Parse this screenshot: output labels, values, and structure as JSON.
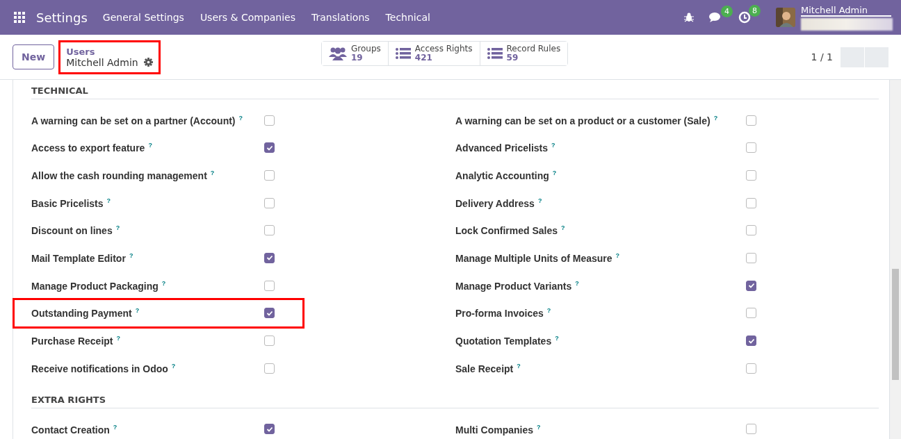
{
  "navbar": {
    "app_title": "Settings",
    "menu": [
      "General Settings",
      "Users & Companies",
      "Translations",
      "Technical"
    ],
    "messages_count": "4",
    "activities_count": "8",
    "user_name": "Mitchell Admin"
  },
  "control_panel": {
    "new_button": "New",
    "breadcrumb": "Users",
    "record_title": "Mitchell Admin",
    "highlighted": true,
    "smart_buttons": [
      {
        "kind": "groups",
        "label": "Groups",
        "count": "19"
      },
      {
        "kind": "list",
        "label": "Access Rights",
        "count": "421"
      },
      {
        "kind": "list",
        "label": "Record Rules",
        "count": "59"
      }
    ],
    "pager": "1 / 1"
  },
  "sections": [
    {
      "title": "TECHNICAL",
      "rows": [
        {
          "left": {
            "label": "A warning can be set on a partner (Account)",
            "checked": false,
            "highlighted": false
          },
          "right": {
            "label": "A warning can be set on a product or a customer (Sale)",
            "checked": false
          }
        },
        {
          "left": {
            "label": "Access to export feature",
            "checked": true,
            "highlighted": false
          },
          "right": {
            "label": "Advanced Pricelists",
            "checked": false
          }
        },
        {
          "left": {
            "label": "Allow the cash rounding management",
            "checked": false,
            "highlighted": false
          },
          "right": {
            "label": "Analytic Accounting",
            "checked": false
          }
        },
        {
          "left": {
            "label": "Basic Pricelists",
            "checked": false,
            "highlighted": false
          },
          "right": {
            "label": "Delivery Address",
            "checked": false
          }
        },
        {
          "left": {
            "label": "Discount on lines",
            "checked": false,
            "highlighted": false
          },
          "right": {
            "label": "Lock Confirmed Sales",
            "checked": false
          }
        },
        {
          "left": {
            "label": "Mail Template Editor",
            "checked": true,
            "highlighted": false
          },
          "right": {
            "label": "Manage Multiple Units of Measure",
            "checked": false
          }
        },
        {
          "left": {
            "label": "Manage Product Packaging",
            "checked": false,
            "highlighted": false
          },
          "right": {
            "label": "Manage Product Variants",
            "checked": true
          }
        },
        {
          "left": {
            "label": "Outstanding Payment",
            "checked": true,
            "highlighted": true
          },
          "right": {
            "label": "Pro-forma Invoices",
            "checked": false
          }
        },
        {
          "left": {
            "label": "Purchase Receipt",
            "checked": false,
            "highlighted": false
          },
          "right": {
            "label": "Quotation Templates",
            "checked": true
          }
        },
        {
          "left": {
            "label": "Receive notifications in Odoo",
            "checked": false,
            "highlighted": false
          },
          "right": {
            "label": "Sale Receipt",
            "checked": false
          }
        }
      ]
    },
    {
      "title": "EXTRA RIGHTS",
      "rows": [
        {
          "left": {
            "label": "Contact Creation",
            "checked": true,
            "highlighted": false
          },
          "right": {
            "label": "Multi Companies",
            "checked": false
          }
        }
      ]
    }
  ],
  "help_mark": "?"
}
